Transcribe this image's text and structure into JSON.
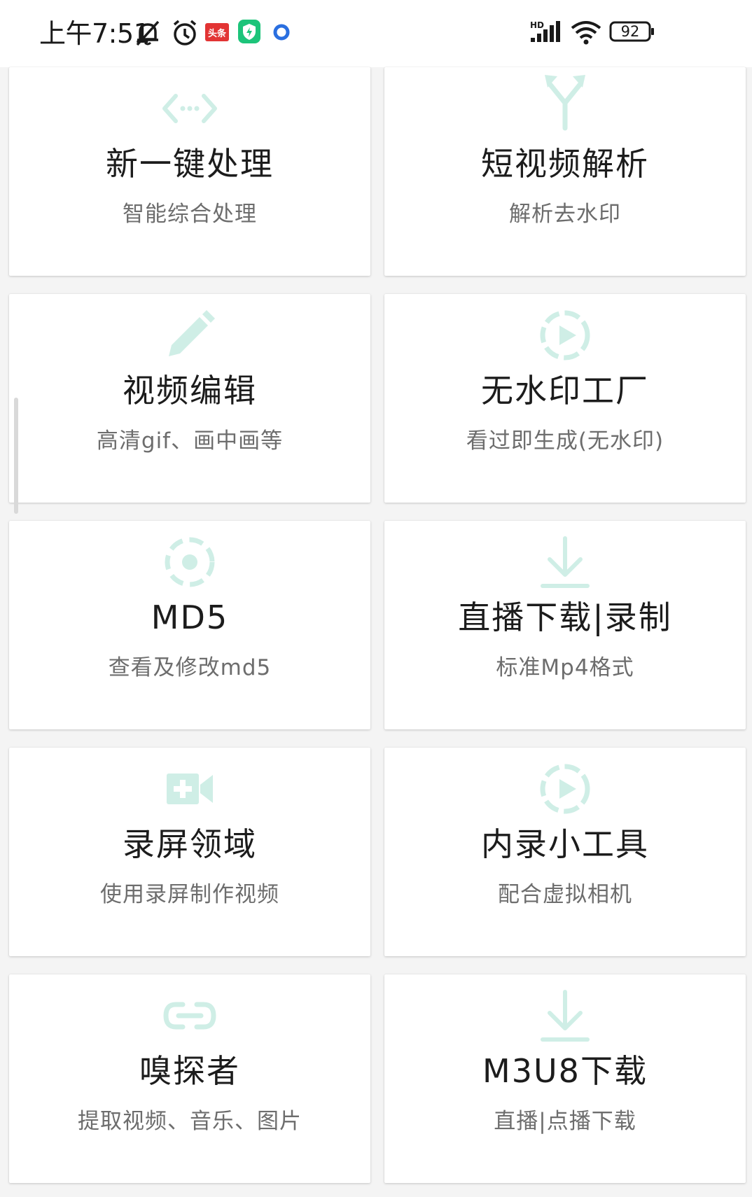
{
  "status_bar": {
    "time": "上午7:51",
    "battery": "92",
    "icons": [
      "mute-icon",
      "alarm-icon",
      "toutiao-icon",
      "security-app-icon",
      "browser-dot-icon",
      "hd-signal-icon",
      "wifi-icon",
      "battery-icon"
    ],
    "toutiao_label": "头条",
    "hd_label": "HD"
  },
  "accent_color": "#cfeee6",
  "cards": [
    {
      "title": "新一键处理",
      "subtitle": "智能综合处理",
      "icon": "code-arrows-icon"
    },
    {
      "title": "短视频解析",
      "subtitle": "解析去水印",
      "icon": "merge-arrows-icon"
    },
    {
      "title": "视频编辑",
      "subtitle": "高清gif、画中画等",
      "icon": "pencil-icon"
    },
    {
      "title": "无水印工厂",
      "subtitle": "看过即生成(无水印)",
      "icon": "dashed-play-icon"
    },
    {
      "title": "MD5",
      "subtitle": "查看及修改md5",
      "icon": "dashed-target-icon"
    },
    {
      "title": "直播下载|录制",
      "subtitle": "标准Mp4格式",
      "icon": "download-icon"
    },
    {
      "title": "录屏领域",
      "subtitle": "使用录屏制作视频",
      "icon": "video-plus-icon"
    },
    {
      "title": "内录小工具",
      "subtitle": "配合虚拟相机",
      "icon": "dashed-play-icon"
    },
    {
      "title": "嗅探者",
      "subtitle": "提取视频、音乐、图片",
      "icon": "link-icon"
    },
    {
      "title": "M3U8下载",
      "subtitle": "直播|点播下载",
      "icon": "download-icon"
    }
  ]
}
